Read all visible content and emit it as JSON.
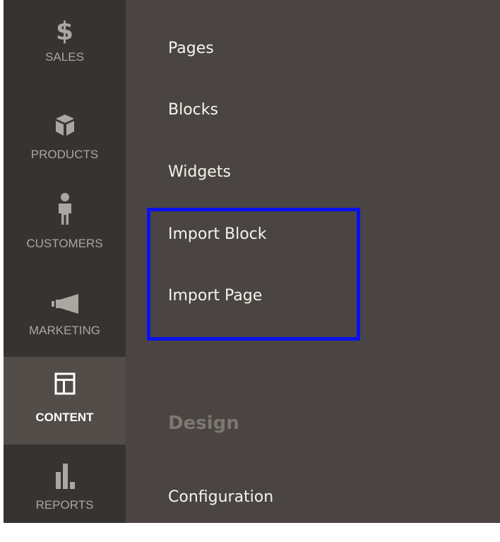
{
  "sidebar": {
    "items": [
      {
        "label": "SALES",
        "icon": "dollar-icon",
        "glyph": "$",
        "active": false
      },
      {
        "label": "PRODUCTS",
        "icon": "box-icon",
        "active": false
      },
      {
        "label": "CUSTOMERS",
        "icon": "person-icon",
        "active": false
      },
      {
        "label": "MARKETING",
        "icon": "megaphone-icon",
        "active": false
      },
      {
        "label": "CONTENT",
        "icon": "layout-icon",
        "active": true
      },
      {
        "label": "REPORTS",
        "icon": "bar-chart-icon",
        "active": false
      }
    ]
  },
  "submenu": {
    "links": [
      "Pages",
      "Blocks",
      "Widgets",
      "Import Block",
      "Import Page"
    ],
    "design_heading": "Design",
    "design_links": [
      "Configuration"
    ]
  },
  "colors": {
    "sidebar_bg": "#373330",
    "panel_bg": "#4a4542",
    "active_bg": "#524d49",
    "highlight_border": "#0a10ee",
    "link_text": "#f7f3eb",
    "muted_heading": "#7d7771"
  }
}
